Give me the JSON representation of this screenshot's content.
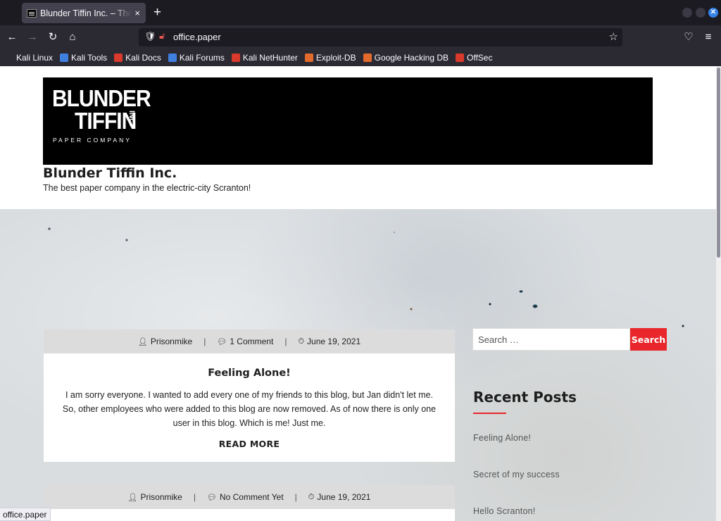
{
  "browser": {
    "tab_title": "Blunder Tiffin Inc. – The best paper company in the electric-city Scranton!",
    "tab_close": "×",
    "new_tab": "+",
    "url": "office.paper",
    "bookmarks": [
      {
        "label": "Kali Linux",
        "color": "#2b2a33"
      },
      {
        "label": "Kali Tools",
        "color": "#3f7fe0"
      },
      {
        "label": "Kali Docs",
        "color": "#d93a2b"
      },
      {
        "label": "Kali Forums",
        "color": "#3f7fe0"
      },
      {
        "label": "Kali NetHunter",
        "color": "#d93a2b"
      },
      {
        "label": "Exploit-DB",
        "color": "#e26a2c"
      },
      {
        "label": "Google Hacking DB",
        "color": "#e26a2c"
      },
      {
        "label": "OffSec",
        "color": "#d93a2b"
      }
    ],
    "status_url": "office.paper"
  },
  "site": {
    "logo_line1": "BLUNDER",
    "logo_line2": "TIFFIN",
    "logo_inc": "INC.",
    "logo_sub": "PAPER COMPANY",
    "title": "Blunder Tiffin Inc.",
    "description": "The best paper company in the electric-city Scranton!"
  },
  "posts": [
    {
      "author": "Prisonmike",
      "comments": "1 Comment",
      "date": "June 19, 2021",
      "title": "Feeling Alone!",
      "excerpt": "I am sorry everyone. I wanted to add every one of my friends to this blog, but Jan didn't let me. So, other employees who were added to this blog are now removed. As of now there is only one user in this blog. Which is me! Just me.",
      "read_more": "READ MORE"
    },
    {
      "author": "Prisonmike",
      "comments": "No Comment Yet",
      "date": "June 19, 2021"
    }
  ],
  "sidebar": {
    "search_placeholder": "Search …",
    "search_button": "Search",
    "recent_title": "Recent Posts",
    "recent_posts": [
      "Feeling Alone!",
      "Secret of my success",
      "Hello Scranton!"
    ]
  },
  "colors": {
    "accent": "#e8262b",
    "chrome_dark": "#1c1b22",
    "chrome": "#2b2a33"
  }
}
